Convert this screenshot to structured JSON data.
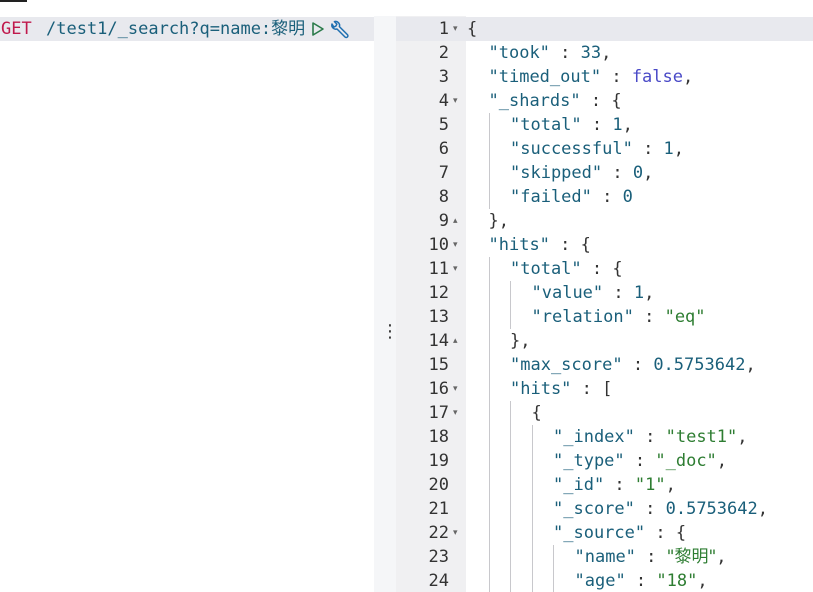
{
  "request": {
    "method": "GET",
    "url_ascii": "/test1/_search?q=name:",
    "url_cjk": "黎明"
  },
  "icons": {
    "run": "play-icon",
    "settings": "wrench-icon",
    "resize": "vertical-ellipsis-icon"
  },
  "colors": {
    "method": "#c0194c",
    "key": "#1a5f7a",
    "string": "#2e7d32",
    "boolean": "#4a4ac7",
    "gutter_bg": "#f0f0f2",
    "active_line": "#e8e9ee"
  },
  "response": {
    "lines": [
      {
        "n": "1",
        "fold": "▾",
        "indent": 0,
        "tokens": [
          {
            "t": "p",
            "v": "{"
          }
        ]
      },
      {
        "n": "2",
        "fold": "",
        "indent": 1,
        "tokens": [
          {
            "t": "k",
            "v": "\"took\""
          },
          {
            "t": "p",
            "v": " : "
          },
          {
            "t": "n",
            "v": "33"
          },
          {
            "t": "p",
            "v": ","
          }
        ]
      },
      {
        "n": "3",
        "fold": "",
        "indent": 1,
        "tokens": [
          {
            "t": "k",
            "v": "\"timed_out\""
          },
          {
            "t": "p",
            "v": " : "
          },
          {
            "t": "b",
            "v": "false"
          },
          {
            "t": "p",
            "v": ","
          }
        ]
      },
      {
        "n": "4",
        "fold": "▾",
        "indent": 1,
        "tokens": [
          {
            "t": "k",
            "v": "\"_shards\""
          },
          {
            "t": "p",
            "v": " : {"
          }
        ]
      },
      {
        "n": "5",
        "fold": "",
        "indent": 2,
        "tokens": [
          {
            "t": "k",
            "v": "\"total\""
          },
          {
            "t": "p",
            "v": " : "
          },
          {
            "t": "n",
            "v": "1"
          },
          {
            "t": "p",
            "v": ","
          }
        ]
      },
      {
        "n": "6",
        "fold": "",
        "indent": 2,
        "tokens": [
          {
            "t": "k",
            "v": "\"successful\""
          },
          {
            "t": "p",
            "v": " : "
          },
          {
            "t": "n",
            "v": "1"
          },
          {
            "t": "p",
            "v": ","
          }
        ]
      },
      {
        "n": "7",
        "fold": "",
        "indent": 2,
        "tokens": [
          {
            "t": "k",
            "v": "\"skipped\""
          },
          {
            "t": "p",
            "v": " : "
          },
          {
            "t": "n",
            "v": "0"
          },
          {
            "t": "p",
            "v": ","
          }
        ]
      },
      {
        "n": "8",
        "fold": "",
        "indent": 2,
        "tokens": [
          {
            "t": "k",
            "v": "\"failed\""
          },
          {
            "t": "p",
            "v": " : "
          },
          {
            "t": "n",
            "v": "0"
          }
        ]
      },
      {
        "n": "9",
        "fold": "▴",
        "indent": 1,
        "tokens": [
          {
            "t": "p",
            "v": "},"
          }
        ]
      },
      {
        "n": "10",
        "fold": "▾",
        "indent": 1,
        "tokens": [
          {
            "t": "k",
            "v": "\"hits\""
          },
          {
            "t": "p",
            "v": " : {"
          }
        ]
      },
      {
        "n": "11",
        "fold": "▾",
        "indent": 2,
        "tokens": [
          {
            "t": "k",
            "v": "\"total\""
          },
          {
            "t": "p",
            "v": " : {"
          }
        ]
      },
      {
        "n": "12",
        "fold": "",
        "indent": 3,
        "tokens": [
          {
            "t": "k",
            "v": "\"value\""
          },
          {
            "t": "p",
            "v": " : "
          },
          {
            "t": "n",
            "v": "1"
          },
          {
            "t": "p",
            "v": ","
          }
        ]
      },
      {
        "n": "13",
        "fold": "",
        "indent": 3,
        "tokens": [
          {
            "t": "k",
            "v": "\"relation\""
          },
          {
            "t": "p",
            "v": " : "
          },
          {
            "t": "s",
            "v": "\"eq\""
          }
        ]
      },
      {
        "n": "14",
        "fold": "▴",
        "indent": 2,
        "tokens": [
          {
            "t": "p",
            "v": "},"
          }
        ]
      },
      {
        "n": "15",
        "fold": "",
        "indent": 2,
        "tokens": [
          {
            "t": "k",
            "v": "\"max_score\""
          },
          {
            "t": "p",
            "v": " : "
          },
          {
            "t": "n",
            "v": "0.5753642"
          },
          {
            "t": "p",
            "v": ","
          }
        ]
      },
      {
        "n": "16",
        "fold": "▾",
        "indent": 2,
        "tokens": [
          {
            "t": "k",
            "v": "\"hits\""
          },
          {
            "t": "p",
            "v": " : ["
          }
        ]
      },
      {
        "n": "17",
        "fold": "▾",
        "indent": 3,
        "tokens": [
          {
            "t": "p",
            "v": "{"
          }
        ]
      },
      {
        "n": "18",
        "fold": "",
        "indent": 4,
        "tokens": [
          {
            "t": "k",
            "v": "\"_index\""
          },
          {
            "t": "p",
            "v": " : "
          },
          {
            "t": "s",
            "v": "\"test1\""
          },
          {
            "t": "p",
            "v": ","
          }
        ]
      },
      {
        "n": "19",
        "fold": "",
        "indent": 4,
        "tokens": [
          {
            "t": "k",
            "v": "\"_type\""
          },
          {
            "t": "p",
            "v": " : "
          },
          {
            "t": "s",
            "v": "\"_doc\""
          },
          {
            "t": "p",
            "v": ","
          }
        ]
      },
      {
        "n": "20",
        "fold": "",
        "indent": 4,
        "tokens": [
          {
            "t": "k",
            "v": "\"_id\""
          },
          {
            "t": "p",
            "v": " : "
          },
          {
            "t": "s",
            "v": "\"1\""
          },
          {
            "t": "p",
            "v": ","
          }
        ]
      },
      {
        "n": "21",
        "fold": "",
        "indent": 4,
        "tokens": [
          {
            "t": "k",
            "v": "\"_score\""
          },
          {
            "t": "p",
            "v": " : "
          },
          {
            "t": "n",
            "v": "0.5753642"
          },
          {
            "t": "p",
            "v": ","
          }
        ]
      },
      {
        "n": "22",
        "fold": "▾",
        "indent": 4,
        "tokens": [
          {
            "t": "k",
            "v": "\"_source\""
          },
          {
            "t": "p",
            "v": " : {"
          }
        ]
      },
      {
        "n": "23",
        "fold": "",
        "indent": 5,
        "tokens": [
          {
            "t": "k",
            "v": "\"name\""
          },
          {
            "t": "p",
            "v": " : "
          },
          {
            "t": "s",
            "v": "\"黎明\"",
            "cjk": true
          },
          {
            "t": "p",
            "v": ","
          }
        ]
      },
      {
        "n": "24",
        "fold": "",
        "indent": 5,
        "tokens": [
          {
            "t": "k",
            "v": "\"age\""
          },
          {
            "t": "p",
            "v": " : "
          },
          {
            "t": "s",
            "v": "\"18\""
          },
          {
            "t": "p",
            "v": ","
          }
        ]
      }
    ]
  }
}
